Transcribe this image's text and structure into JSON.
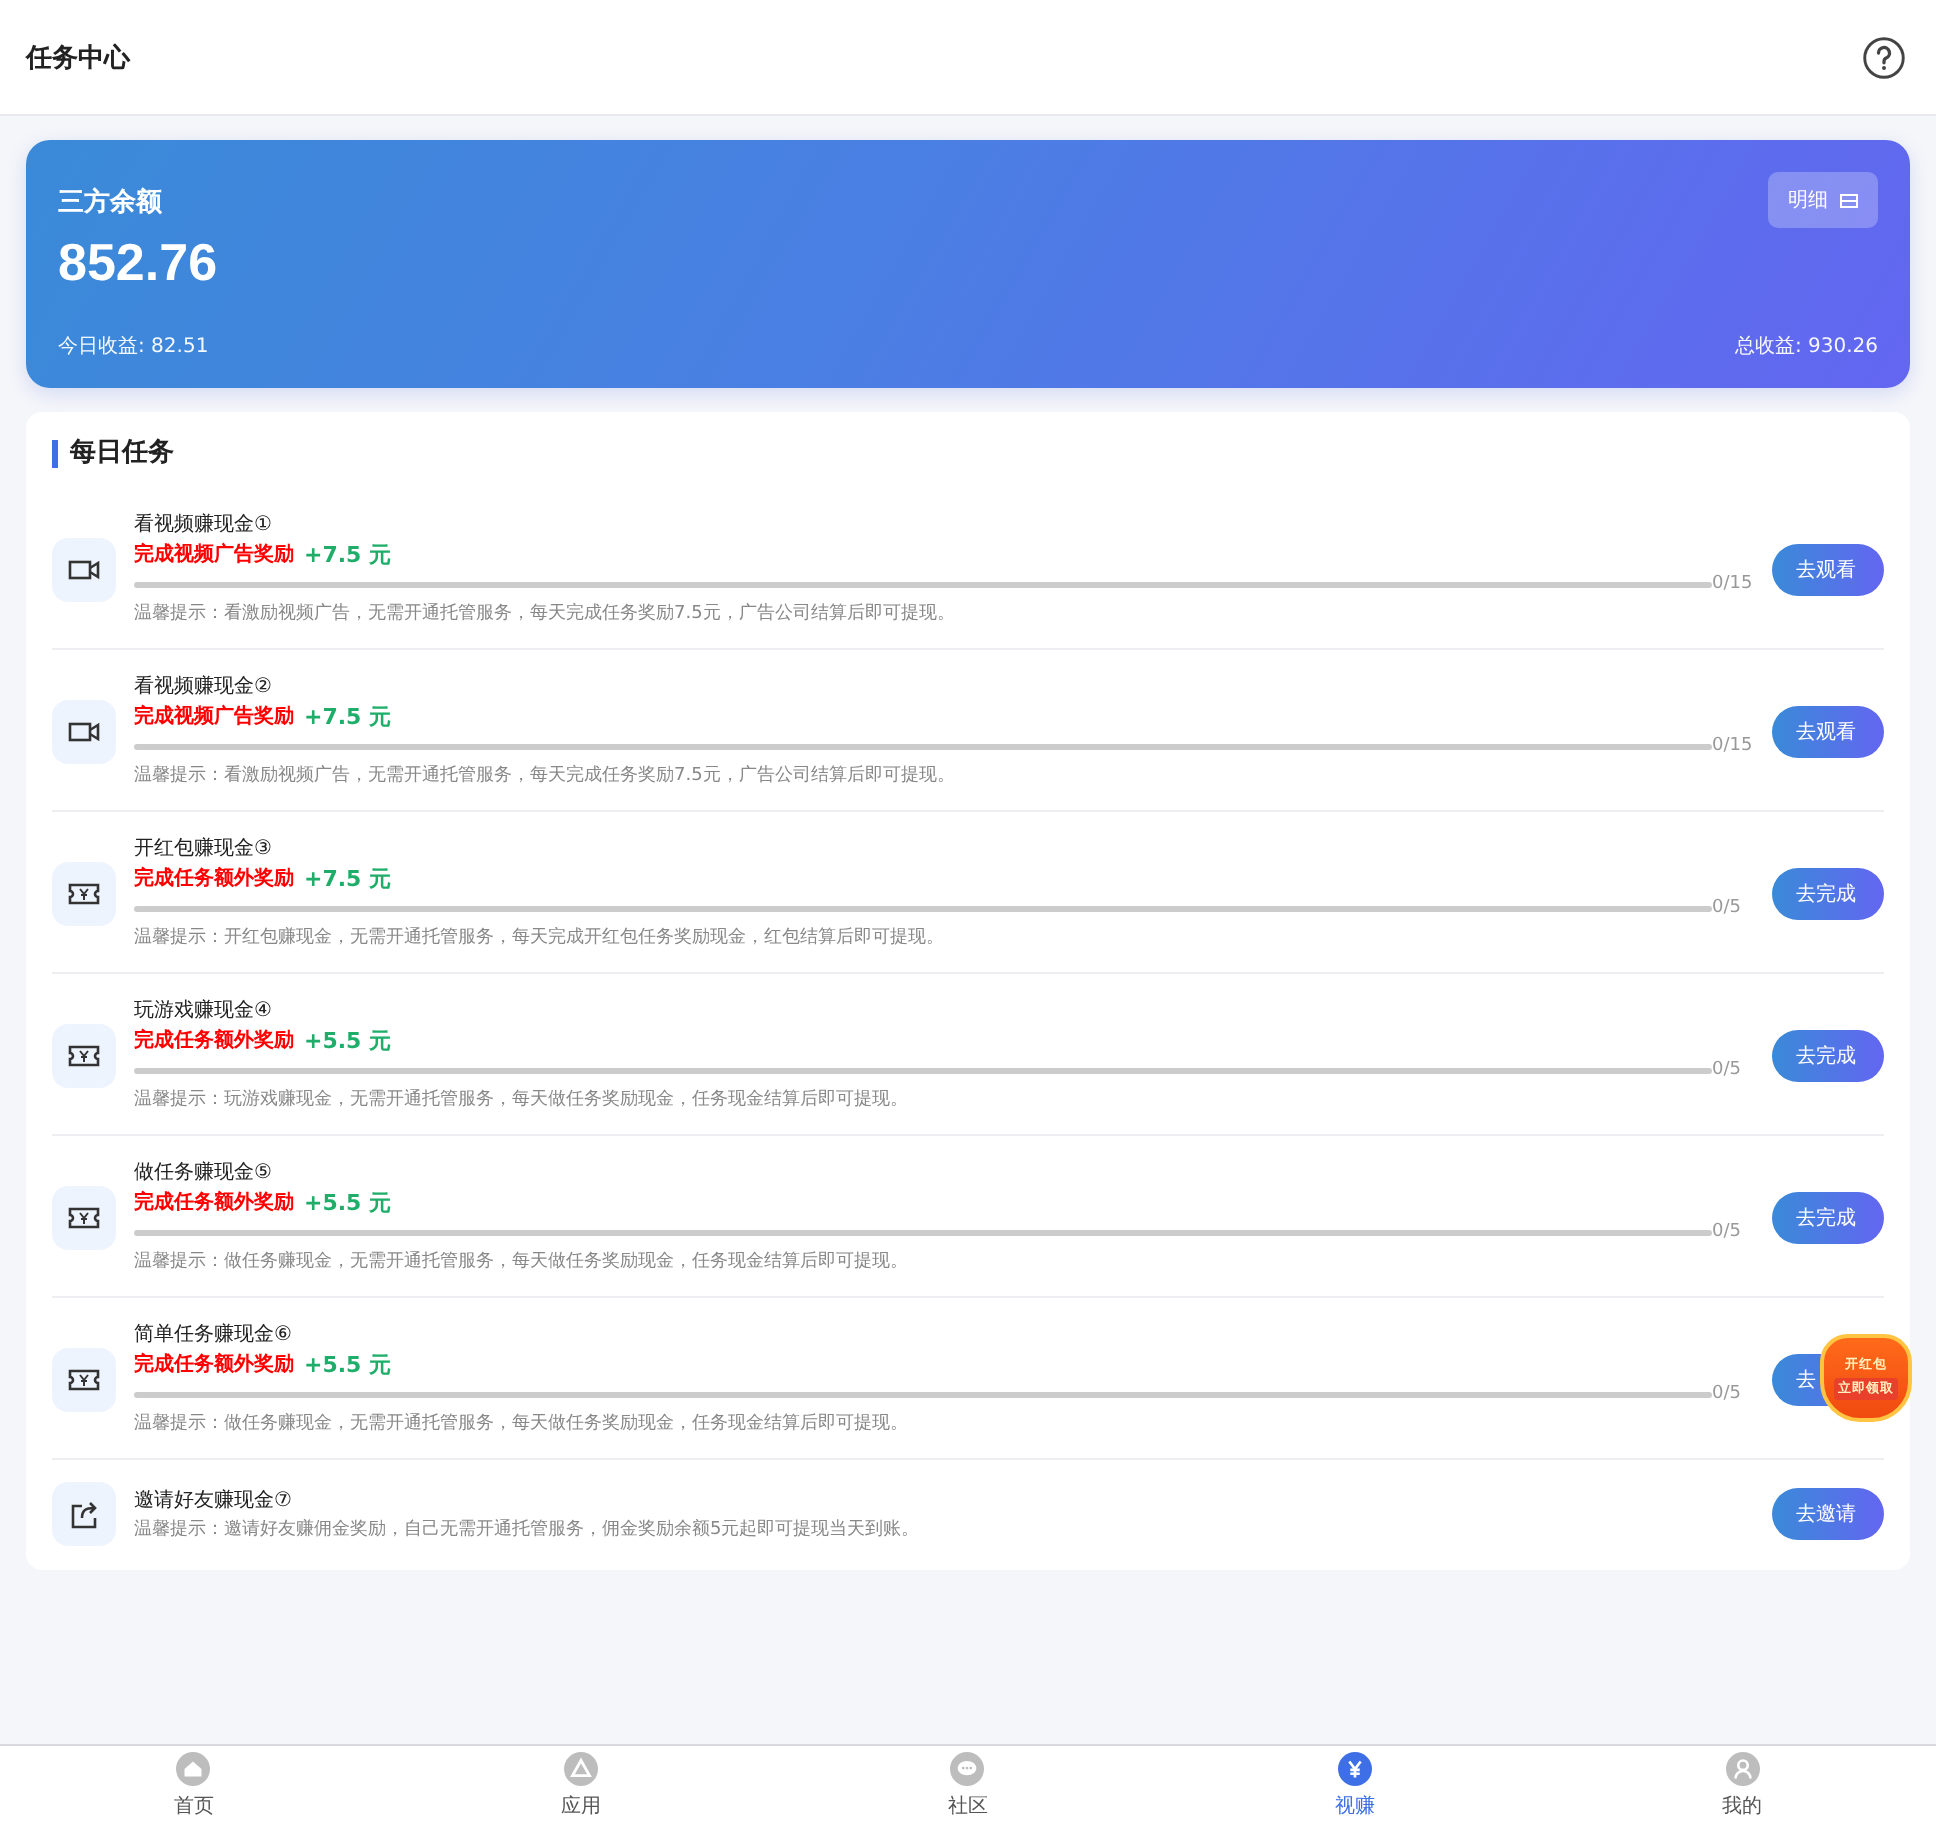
{
  "header": {
    "title": "任务中心"
  },
  "balance": {
    "label": "三方余额",
    "amount": "852.76",
    "detail_button": "明细",
    "today": "今日收益: 82.51",
    "total": "总收益: 930.26"
  },
  "daily": {
    "title": "每日任务",
    "tasks": [
      {
        "kind": "video",
        "title": "看视频赚现金①",
        "reward_label": "完成视频广告奖励",
        "reward": "+7.5 元",
        "level": 0,
        "count": "0/15",
        "tip": "温馨提示：看激励视频广告，无需开通托管服务，每天完成任务奖励7.5元，广告公司结算后即可提现。",
        "button": "去观看"
      },
      {
        "kind": "video",
        "title": "看视频赚现金②",
        "reward_label": "完成视频广告奖励",
        "reward": "+7.5 元",
        "level": 0,
        "count": "0/15",
        "tip": "温馨提示：看激励视频广告，无需开通托管服务，每天完成任务奖励7.5元，广告公司结算后即可提现。",
        "button": "去观看"
      },
      {
        "kind": "ticket",
        "title": "开红包赚现金③",
        "reward_label": "完成任务额外奖励",
        "reward": "+7.5 元",
        "level": 0,
        "count": "0/5",
        "tip": "温馨提示：开红包赚现金，无需开通托管服务，每天完成开红包任务奖励现金，红包结算后即可提现。",
        "button": "去完成"
      },
      {
        "kind": "ticket",
        "title": "玩游戏赚现金④",
        "reward_label": "完成任务额外奖励",
        "reward": "+5.5 元",
        "level": 0,
        "count": "0/5",
        "tip": "温馨提示：玩游戏赚现金，无需开通托管服务，每天做任务奖励现金，任务现金结算后即可提现。",
        "button": "去完成"
      },
      {
        "kind": "ticket",
        "title": "做任务赚现金⑤",
        "reward_label": "完成任务额外奖励",
        "reward": "+5.5 元",
        "level": 0,
        "count": "0/5",
        "tip": "温馨提示：做任务赚现金，无需开通托管服务，每天做任务奖励现金，任务现金结算后即可提现。",
        "button": "去完成"
      },
      {
        "kind": "ticket",
        "title": "简单任务赚现金⑥",
        "reward_label": "完成任务额外奖励",
        "reward": "+5.5 元",
        "level": 0,
        "count": "0/5",
        "tip": "温馨提示：做任务赚现金，无需开通托管服务，每天做任务奖励现金，任务现金结算后即可提现。",
        "button": "去"
      },
      {
        "kind": "share",
        "title": "邀请好友赚现金⑦",
        "tip": "温馨提示：邀请好友赚佣金奖励，自己无需开通托管服务，佣金奖励余额5元起即可提现当天到账。",
        "button": "去邀请"
      }
    ]
  },
  "floating_badge": {
    "line_1": "开红包",
    "line_2": "立即领取"
  },
  "nav": [
    {
      "label": "首页",
      "selected": false
    },
    {
      "label": "应用",
      "selected": false
    },
    {
      "label": "社区",
      "selected": false
    },
    {
      "label": "视赚",
      "selected": true
    },
    {
      "label": "我的",
      "selected": false
    }
  ]
}
